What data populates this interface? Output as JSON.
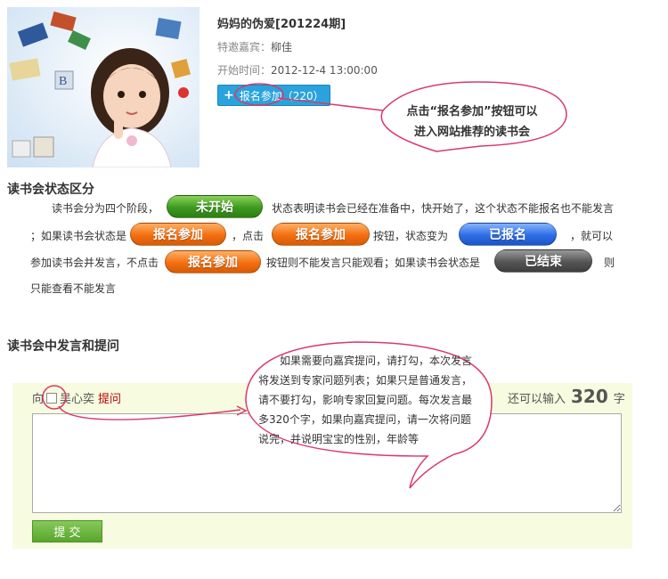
{
  "episode": {
    "title": "妈妈的伪爱[201224期]",
    "guest_label": "特邀嘉宾：",
    "guest_name": "柳佳",
    "start_label": "开始时间：",
    "start_time": "2012-12-4 13:00:00",
    "signup_button": "报名参加",
    "signup_count": "（220）"
  },
  "callout_top": {
    "line1": "点击“报名参加”按钮可以",
    "line2": "进入网站推荐的读书会"
  },
  "status_section": {
    "title": "读书会状态区分",
    "t1": "读书会分为四个阶段，",
    "pill_not_started": "未开始",
    "t2": "状态表明读书会已经在准备中，快开始了，这个状态不能报名也不能发言",
    "t3": "；如果读书会状态是",
    "pill_signup": "报名参加",
    "t4": "，点击",
    "t5": "按钮，状态变为",
    "pill_registered": "已报名",
    "t6": "，就可以",
    "t7": "参加读书会并发言，不点击",
    "t8": "按钮则不能发言只能观看；如果读书会状态是",
    "pill_ended": "已结束",
    "t9": "则",
    "t10": "只能查看不能发言"
  },
  "speak_section": {
    "title": "读书会中发言和提问",
    "ask_prefix": "向",
    "ask_person": "吴心奕",
    "ask_link": "提问",
    "remaining_prefix": "还可以输入",
    "remaining_count": "320",
    "remaining_suffix": "字",
    "textarea_value": "",
    "submit_button": "提 交"
  },
  "callout_mid": {
    "lines": [
      "如果需要向嘉宾提问，请打勾，本次发言",
      "将发送到专家问题列表；如果只是普通发言，",
      "请不要打勾，影响专家回复问题。每次发言最",
      "多320个字，如果向嘉宾提问，请一次将问题",
      "说完，并说明宝宝的性别，年龄等"
    ]
  },
  "colors": {
    "accent_blue": "#2aa3dc",
    "callout_border": "#d83a6a",
    "speak_bg": "#f7fbe0",
    "link_red": "#c00000",
    "submit_green": "#6cba3c"
  }
}
